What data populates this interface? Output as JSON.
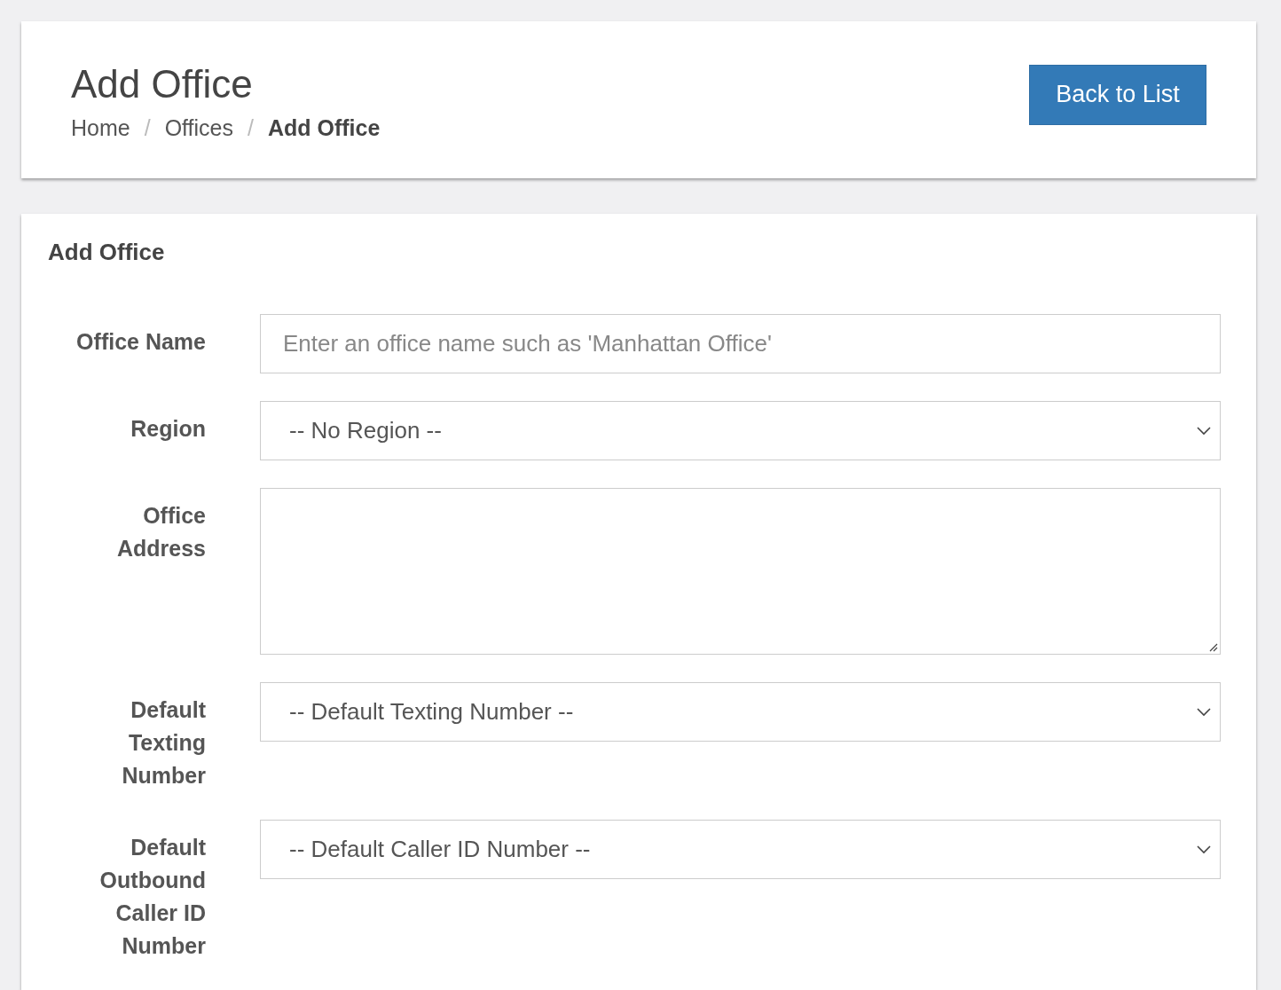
{
  "header": {
    "title": "Add Office",
    "breadcrumb": [
      {
        "label": "Home",
        "current": false
      },
      {
        "label": "Offices",
        "current": false
      },
      {
        "label": "Add Office",
        "current": true
      }
    ],
    "separator": "/",
    "button": "Back to List"
  },
  "form": {
    "title": "Add Office",
    "fields": [
      {
        "label": "Office Name",
        "kind": "text",
        "placeholder": "Enter an office name such as 'Manhattan Office'"
      },
      {
        "label": "Region",
        "kind": "select",
        "value": "-- No Region --"
      },
      {
        "label": "Office Address",
        "kind": "textarea"
      },
      {
        "label": "Default Texting Number",
        "kind": "select",
        "value": "-- Default Texting Number --"
      },
      {
        "label": "Default Outbound Caller ID Number",
        "kind": "select",
        "value": "-- Default Caller ID Number --"
      }
    ]
  }
}
